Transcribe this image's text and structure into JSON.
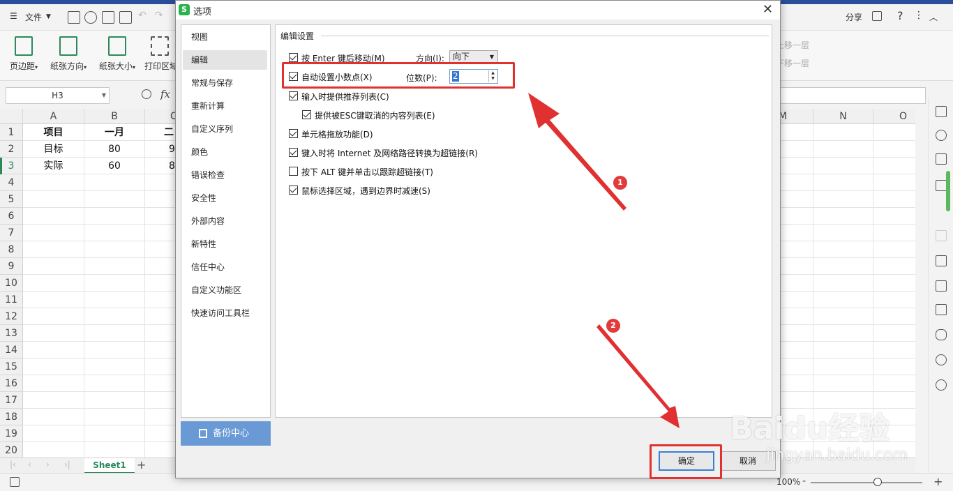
{
  "app": {
    "file_menu": "文件",
    "share": "分享",
    "ribbon": [
      {
        "label": "页边距",
        "icon": "margin-icon"
      },
      {
        "label": "纸张方向",
        "icon": "orientation-icon"
      },
      {
        "label": "纸张大小",
        "icon": "paper-size-icon"
      },
      {
        "label": "打印区域",
        "icon": "print-area-icon"
      }
    ],
    "ribbon_right": [
      "上移一层",
      "下移一层"
    ],
    "name_box": "H3",
    "fx": "fx",
    "columns": [
      "A",
      "B",
      "C",
      "M",
      "N",
      "O"
    ],
    "rows": [
      "1",
      "2",
      "3",
      "4",
      "5",
      "6",
      "7",
      "8",
      "9",
      "10",
      "11",
      "12",
      "13",
      "14",
      "15",
      "16",
      "17",
      "18",
      "19",
      "20"
    ],
    "cells": {
      "a1": "项目",
      "b1": "一月",
      "c1": "二",
      "a2": "目标",
      "b2": "80",
      "c2": "9",
      "a3": "实际",
      "b3": "60",
      "c3": "8"
    },
    "sheet_tab": "Sheet1",
    "zoom": "100%"
  },
  "dialog": {
    "title": "选项",
    "nav": [
      "视图",
      "编辑",
      "常规与保存",
      "重新计算",
      "自定义序列",
      "颜色",
      "错误检查",
      "安全性",
      "外部内容",
      "新特性",
      "信任中心",
      "自定义功能区",
      "快速访问工具栏"
    ],
    "active_nav": "编辑",
    "backup": "备份中心",
    "group_title": "编辑设置",
    "options": [
      {
        "label": "按 Enter 键后移动(M)",
        "checked": true
      },
      {
        "label": "自动设置小数点(X)",
        "checked": true
      },
      {
        "label": "输入时提供推荐列表(C)",
        "checked": true
      },
      {
        "label": "提供被ESC键取消的内容列表(E)",
        "checked": true
      },
      {
        "label": "单元格拖放功能(D)",
        "checked": true
      },
      {
        "label": "键入时将 Internet 及网络路径转换为超链接(R)",
        "checked": true
      },
      {
        "label": "按下 ALT 键并单击以跟踪超链接(T)",
        "checked": false
      },
      {
        "label": "鼠标选择区域，遇到边界时减速(S)",
        "checked": true
      }
    ],
    "direction_label": "方向(I):",
    "direction_value": "向下",
    "digits_label": "位数(P):",
    "digits_value": "2",
    "ok": "确定",
    "cancel": "取消"
  },
  "annotations": {
    "badge1": "1",
    "badge2": "2",
    "accent": "#e03030"
  },
  "watermark": {
    "brand": "Baidu经验",
    "url": "jingyan.baidu.com"
  }
}
